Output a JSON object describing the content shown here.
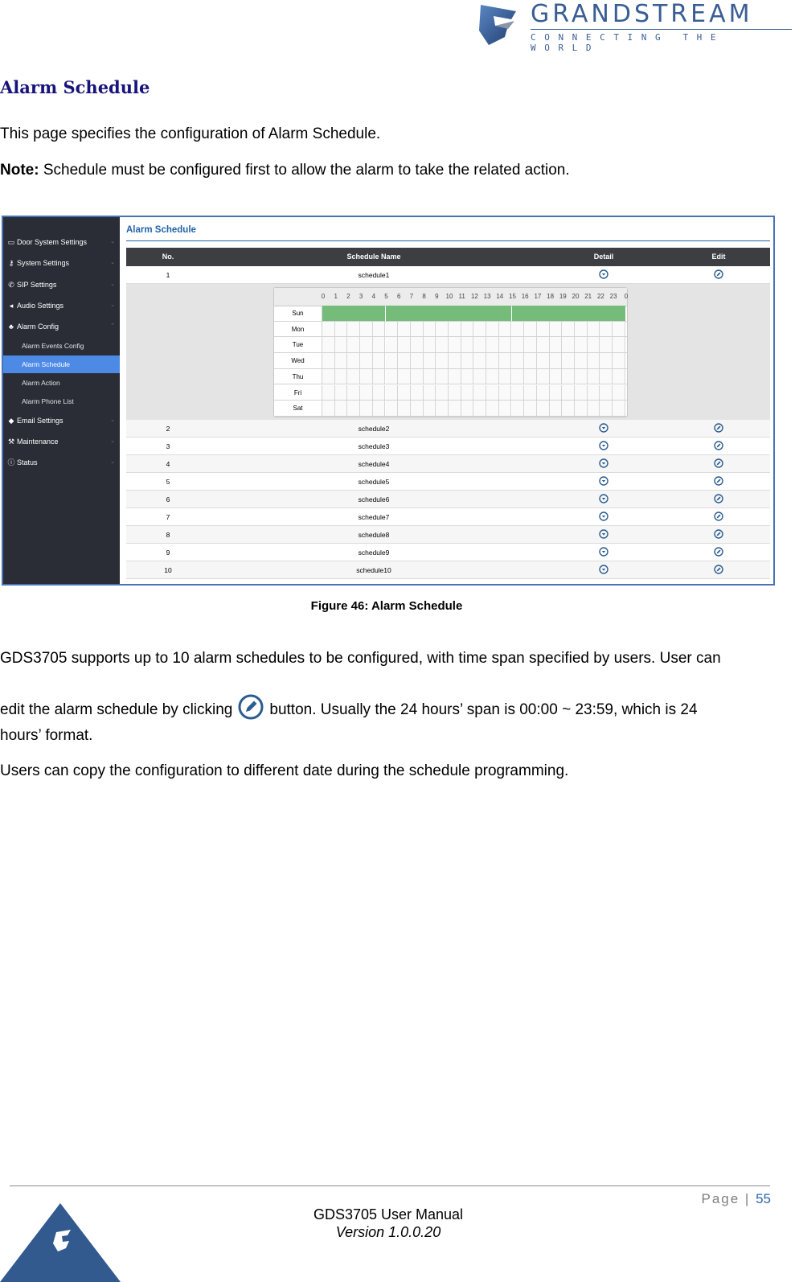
{
  "brand": {
    "name": "GRANDSTREAM",
    "tagline": "CONNECTING THE WORLD",
    "colors": {
      "primary": "#3a5e93",
      "heading": "#17137a",
      "accent": "#4d8ae6",
      "schedule_on": "#75bb7a"
    }
  },
  "section": {
    "title": "Alarm Schedule",
    "intro": "This page specifies the configuration of Alarm Schedule.",
    "note_label": "Note:",
    "note_text": " Schedule must be configured first to allow the alarm to take the related action."
  },
  "figure": {
    "sidebar": {
      "items": [
        {
          "icon": "card-icon",
          "glyph": "▭",
          "label": "Door System Settings",
          "chevron": "⌄"
        },
        {
          "icon": "key-icon",
          "glyph": "⚷",
          "label": "System Settings",
          "chevron": "⌄"
        },
        {
          "icon": "phone-icon",
          "glyph": "✆",
          "label": "SIP Settings",
          "chevron": "⌄"
        },
        {
          "icon": "speaker-icon",
          "glyph": "◂",
          "label": "Audio Settings",
          "chevron": "⌄"
        },
        {
          "icon": "bell-icon",
          "glyph": "♣",
          "label": "Alarm Config",
          "chevron": "⌃"
        }
      ],
      "sub_items": [
        {
          "label": "Alarm Events Config",
          "active": false
        },
        {
          "label": "Alarm Schedule",
          "active": true
        },
        {
          "label": "Alarm Action",
          "active": false
        },
        {
          "label": "Alarm Phone List",
          "active": false
        }
      ],
      "items_after": [
        {
          "icon": "email-icon",
          "glyph": "◆",
          "label": "Email Settings",
          "chevron": "⌄"
        },
        {
          "icon": "wrench-icon",
          "glyph": "⚒",
          "label": "Maintenance",
          "chevron": "⌄"
        },
        {
          "icon": "info-icon",
          "glyph": "ⓘ",
          "label": "Status",
          "chevron": "⌄"
        }
      ]
    },
    "main": {
      "title": "Alarm Schedule",
      "columns": [
        "No.",
        "Schedule Name",
        "Detail",
        "Edit"
      ],
      "rows": [
        {
          "no": "1",
          "name": "schedule1"
        },
        {
          "no": "2",
          "name": "schedule2"
        },
        {
          "no": "3",
          "name": "schedule3"
        },
        {
          "no": "4",
          "name": "schedule4"
        },
        {
          "no": "5",
          "name": "schedule5"
        },
        {
          "no": "6",
          "name": "schedule6"
        },
        {
          "no": "7",
          "name": "schedule7"
        },
        {
          "no": "8",
          "name": "schedule8"
        },
        {
          "no": "9",
          "name": "schedule9"
        },
        {
          "no": "10",
          "name": "schedule10"
        }
      ],
      "detail": {
        "hours": [
          "0",
          "1",
          "2",
          "3",
          "4",
          "5",
          "6",
          "7",
          "8",
          "9",
          "10",
          "11",
          "12",
          "13",
          "14",
          "15",
          "16",
          "17",
          "18",
          "19",
          "20",
          "21",
          "22",
          "23",
          "0"
        ],
        "days": [
          {
            "label": "Sun",
            "active_hours": [
              0,
              24
            ]
          },
          {
            "label": "Mon",
            "active_hours": null
          },
          {
            "label": "Tue",
            "active_hours": null
          },
          {
            "label": "Wed",
            "active_hours": null
          },
          {
            "label": "Thu",
            "active_hours": null
          },
          {
            "label": "Fri",
            "active_hours": null
          },
          {
            "label": "Sat",
            "active_hours": null
          }
        ]
      }
    },
    "caption": "Figure 46: Alarm Schedule"
  },
  "body": {
    "p1": "GDS3705 supports up to 10 alarm schedules to be configured, with time span specified by users. User can",
    "p2_before": "edit the alarm schedule by clicking",
    "p2_after": "button. Usually the 24 hours’ span is 00:00 ~ 23:59, which is 24",
    "p3": "hours’ format.",
    "p4": "Users can copy the configuration to different date during the schedule programming."
  },
  "footer": {
    "page_label": "Page",
    "page_number": "55",
    "manual_title": "GDS3705 User Manual",
    "version": "Version 1.0.0.20"
  }
}
